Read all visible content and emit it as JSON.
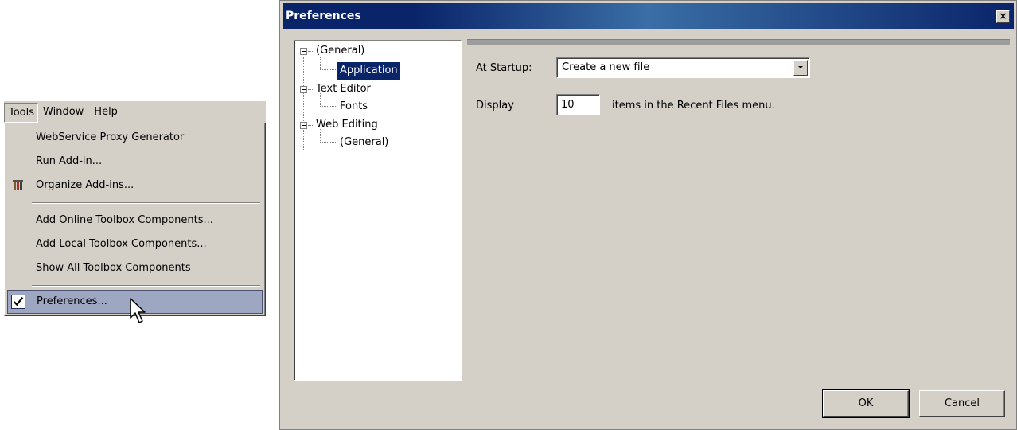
{
  "menubar": {
    "items": [
      "Tools",
      "Window",
      "Help"
    ]
  },
  "tools_menu": {
    "items": [
      {
        "label": "WebService Proxy Generator",
        "icon": ""
      },
      {
        "label": "Run Add-in...",
        "icon": ""
      },
      {
        "label": "Organize Add-ins...",
        "icon": "wrench-icon"
      },
      {
        "label": "Add Online Toolbox Components...",
        "icon": ""
      },
      {
        "label": "Add Local Toolbox Components...",
        "icon": ""
      },
      {
        "label": "Show All Toolbox Components",
        "icon": ""
      },
      {
        "label": "Preferences...",
        "icon": "checkbox-icon",
        "highlighted": true
      }
    ]
  },
  "dialog": {
    "title": "Preferences",
    "close_label": "×",
    "tree": [
      {
        "label": "(General)",
        "expanded": true
      },
      {
        "label": "Application",
        "selected": true
      },
      {
        "label": "Text Editor",
        "expanded": true
      },
      {
        "label": "Fonts"
      },
      {
        "label": "Web Editing",
        "expanded": true
      },
      {
        "label": "(General)"
      }
    ],
    "startup_label": "At Startup:",
    "startup_value": "Create a new file",
    "display_label": "Display",
    "display_value": "10",
    "recent_suffix": "items in the Recent Files menu.",
    "ok_label": "OK",
    "cancel_label": "Cancel"
  },
  "colors": {
    "face": "#d4d0c8",
    "title_dark": "#0a246a",
    "title_light": "#3a6ea5",
    "menu_highlight": "#9ea7c1"
  }
}
